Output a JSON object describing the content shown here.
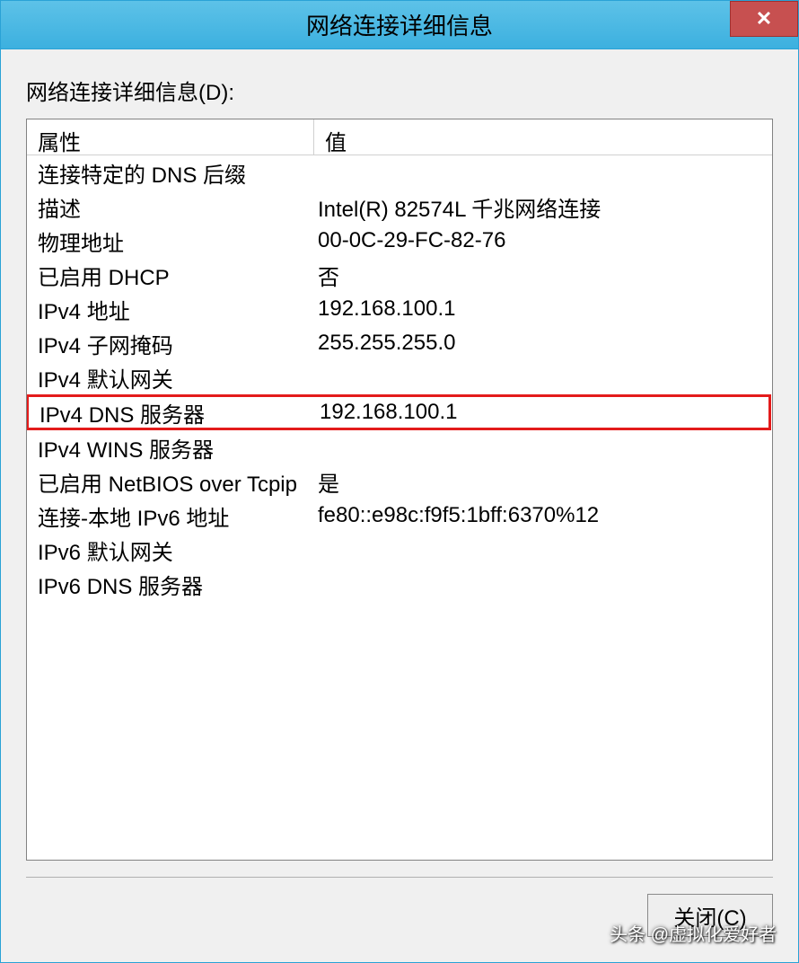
{
  "window": {
    "title": "网络连接详细信息"
  },
  "section_label": "网络连接详细信息(D):",
  "headers": {
    "property": "属性",
    "value": "值"
  },
  "rows": [
    {
      "property": "连接特定的 DNS 后缀",
      "value": ""
    },
    {
      "property": "描述",
      "value": "Intel(R) 82574L 千兆网络连接"
    },
    {
      "property": "物理地址",
      "value": "00-0C-29-FC-82-76"
    },
    {
      "property": "已启用 DHCP",
      "value": "否"
    },
    {
      "property": "IPv4 地址",
      "value": "192.168.100.1"
    },
    {
      "property": "IPv4 子网掩码",
      "value": "255.255.255.0"
    },
    {
      "property": "IPv4 默认网关",
      "value": ""
    },
    {
      "property": "IPv4 DNS 服务器",
      "value": "192.168.100.1",
      "highlighted": true
    },
    {
      "property": "IPv4 WINS 服务器",
      "value": ""
    },
    {
      "property": "已启用 NetBIOS over Tcpip",
      "value": "是"
    },
    {
      "property": "连接-本地 IPv6 地址",
      "value": "fe80::e98c:f9f5:1bff:6370%12"
    },
    {
      "property": "IPv6 默认网关",
      "value": ""
    },
    {
      "property": "IPv6 DNS 服务器",
      "value": ""
    }
  ],
  "buttons": {
    "close": "关闭(C)"
  },
  "watermark": "头条 @虚拟化爱好者"
}
